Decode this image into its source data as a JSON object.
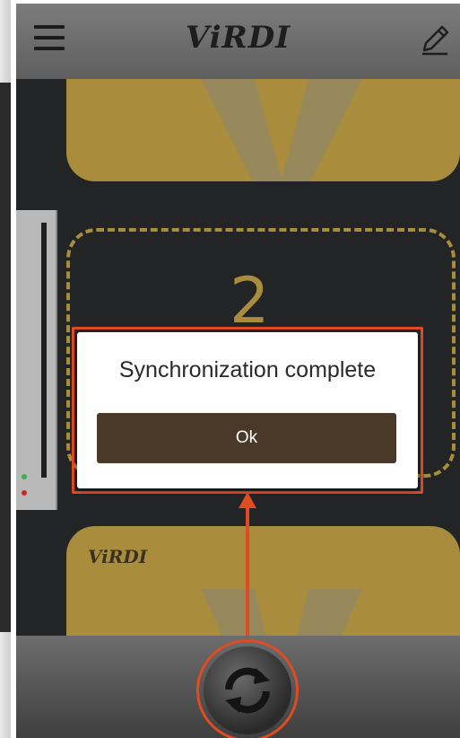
{
  "app": {
    "brand": "ViRDI"
  },
  "cards": {
    "bottom_brand": "ViRDI"
  },
  "slot": {
    "number": "2"
  },
  "dialog": {
    "message": "Synchronization complete",
    "ok_label": "Ok"
  },
  "colors": {
    "accent_gold": "#a98d3c",
    "dialog_button": "#4a3828",
    "annotation": "#e14b22",
    "appbar": "#6f6f6f"
  },
  "icons": {
    "menu": "hamburger-menu-icon",
    "edit": "pencil-icon",
    "sync": "sync-arrows-icon"
  }
}
